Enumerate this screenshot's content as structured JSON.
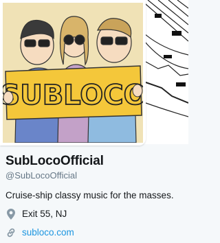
{
  "profile": {
    "display_name": "SubLocoOfficial",
    "handle": "@SubLocoOfficial",
    "bio": "Cruise-ship classy music for the masses.",
    "location": "Exit 55, NJ",
    "website": "subloco.com"
  },
  "avatar": {
    "sign_text": "SUBLOCO",
    "background_color": "#f0e2b6",
    "sign_color": "#f4c73a"
  },
  "colors": {
    "link": "#1b95e0",
    "text": "#14171a",
    "muted": "#657786",
    "icon": "#8899a6"
  },
  "icons": {
    "location": "map-pin-icon",
    "website": "link-icon"
  }
}
